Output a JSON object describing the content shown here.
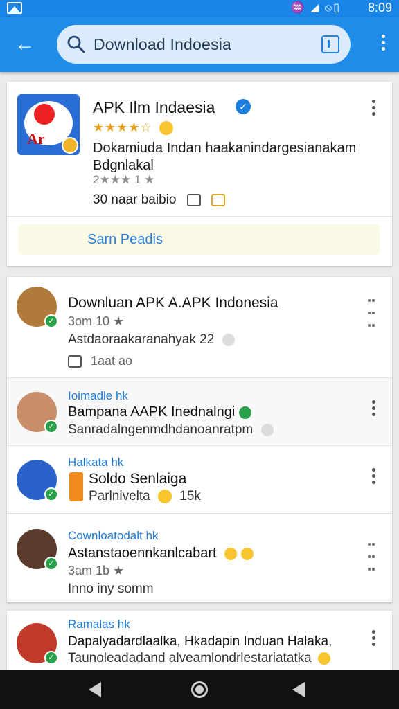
{
  "status_bar": {
    "time": "8:09",
    "icons": "♒ ◢ ⦸▯"
  },
  "search": {
    "query": "Download Indoesia"
  },
  "featured_app": {
    "title": "APK Ilm Indaesia",
    "rating_stars": "★★★★☆",
    "description": "Dokamiuda Indan haakanindargesianakam Bdgnlakal",
    "rating_line": "2★★★ 1 ★",
    "stats": "30 naar baibio",
    "action_label": "Sarn Peadis"
  },
  "list_items": [
    {
      "source": "",
      "title": "Downluan APK A.APK Indonesia",
      "meta": "3om 10 ★",
      "subtitle": "Astdaoraakaranahyak 22",
      "footer": "1aat ao"
    },
    {
      "source": "Ioimadle hk",
      "title": "Bampana AAPK Inednalngi",
      "meta": "",
      "subtitle": "Sanradalngenmdhdanoanratpm",
      "footer": ""
    },
    {
      "source": "Halkata hk",
      "title": "Soldo Senlaiga",
      "meta": "",
      "subtitle": "Parlnivelta",
      "footer": "15k"
    },
    {
      "source": "Cownloatodalt hk",
      "title": "Astanstaoennkanlcabart",
      "meta": "3am 1b ★",
      "subtitle": "Inno iny somm",
      "footer": ""
    },
    {
      "source": "Ramalas hk",
      "title": "Dapalyadardlaalka, Hkadapin Induan Halaka,",
      "meta": "",
      "subtitle": "Taunoleadadand alveamlondrlestariatatka",
      "footer": ""
    }
  ],
  "colors": {
    "primary": "#1f8ce9",
    "accent_link": "#1e7ad6",
    "star": "#e6a11c",
    "verified": "#2aa04a"
  }
}
